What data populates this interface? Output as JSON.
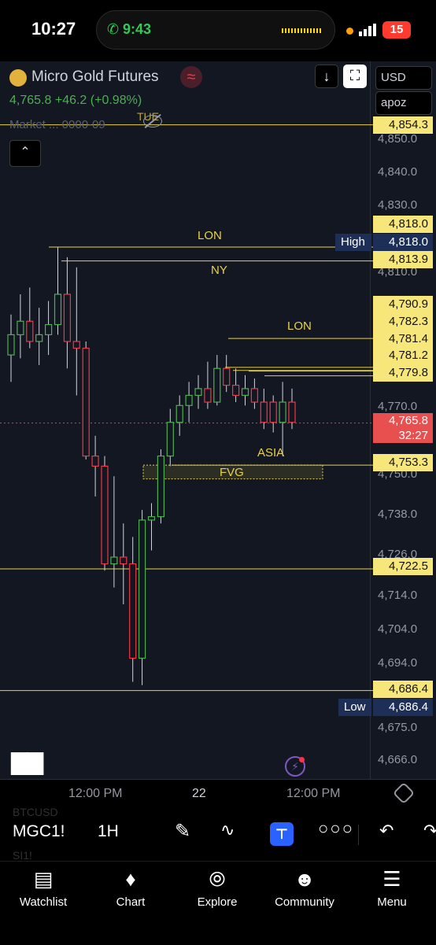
{
  "status": {
    "time": "10:27",
    "call_time": "9:43",
    "battery": "15"
  },
  "header": {
    "symbol_name": "Micro Gold Futures",
    "price": "4,765.8",
    "change": "+46.2 (+0.98%)",
    "market_line": "Market ...  0000-09",
    "hidden_tag": "TUE",
    "currency": "USD",
    "account": "apoz"
  },
  "chart_data": {
    "type": "candlestick",
    "symbol": "MGC1!",
    "interval": "1H",
    "y_ticks": [
      4850.0,
      4840.0,
      4830.0,
      4810.0,
      4770.0,
      4750.0,
      4738.0,
      4726.0,
      4714.0,
      4704.0,
      4694.0,
      4675.0,
      4666.0
    ],
    "y_tick_labels": [
      "4,850.0",
      "4,840.0",
      "4,830.0",
      "4,810.0",
      "4,770.0",
      "4,750.0",
      "4,738.0",
      "4,726.0",
      "4,714.0",
      "4,704.0",
      "4,694.0",
      "4,675.0",
      "4,666.0"
    ],
    "x_labels": [
      "12:00 PM",
      "22",
      "12:00 PM"
    ],
    "levels": [
      {
        "price": 4854.3,
        "label": "4,854.3"
      },
      {
        "price": 4818.0,
        "label": "4,818.0",
        "text": "LON"
      },
      {
        "price": 4813.9,
        "label": "4,813.9",
        "text": "NY"
      },
      {
        "price": 4790.9,
        "label": "4,790.9",
        "text": "LON"
      },
      {
        "price": 4782.3,
        "label": "4,782.3"
      },
      {
        "price": 4781.4,
        "label": "4,781.4"
      },
      {
        "price": 4781.2,
        "label": "4,781.2"
      },
      {
        "price": 4779.8,
        "label": "4,779.8"
      },
      {
        "price": 4753.3,
        "label": "4,753.3",
        "text": "ASIA"
      },
      {
        "price": 4722.5,
        "label": "4,722.5"
      },
      {
        "price": 4686.4,
        "label": "4,686.4"
      }
    ],
    "high": {
      "text": "High",
      "label": "4,818.0"
    },
    "low": {
      "text": "Low",
      "label": "4,686.4"
    },
    "last": {
      "label": "4,765.8",
      "countdown": "32:27"
    },
    "zone": {
      "text": "FVG"
    },
    "candles": [
      {
        "o": 4786,
        "h": 4798,
        "l": 4778,
        "c": 4792
      },
      {
        "o": 4792,
        "h": 4804,
        "l": 4785,
        "c": 4796
      },
      {
        "o": 4796,
        "h": 4806,
        "l": 4788,
        "c": 4790
      },
      {
        "o": 4790,
        "h": 4800,
        "l": 4783,
        "c": 4792
      },
      {
        "o": 4792,
        "h": 4802,
        "l": 4786,
        "c": 4795
      },
      {
        "o": 4795,
        "h": 4818,
        "l": 4792,
        "c": 4804
      },
      {
        "o": 4804,
        "h": 4815,
        "l": 4782,
        "c": 4790
      },
      {
        "o": 4790,
        "h": 4812,
        "l": 4774,
        "c": 4788
      },
      {
        "o": 4788,
        "h": 4790,
        "l": 4755,
        "c": 4756
      },
      {
        "o": 4756,
        "h": 4762,
        "l": 4744,
        "c": 4753
      },
      {
        "o": 4753,
        "h": 4756,
        "l": 4722,
        "c": 4724
      },
      {
        "o": 4724,
        "h": 4750,
        "l": 4717,
        "c": 4726
      },
      {
        "o": 4726,
        "h": 4736,
        "l": 4712,
        "c": 4724
      },
      {
        "o": 4724,
        "h": 4732,
        "l": 4689,
        "c": 4696
      },
      {
        "o": 4696,
        "h": 4740,
        "l": 4688,
        "c": 4737
      },
      {
        "o": 4737,
        "h": 4742,
        "l": 4728,
        "c": 4738
      },
      {
        "o": 4738,
        "h": 4758,
        "l": 4736,
        "c": 4756
      },
      {
        "o": 4756,
        "h": 4770,
        "l": 4753,
        "c": 4766
      },
      {
        "o": 4766,
        "h": 4774,
        "l": 4762,
        "c": 4771
      },
      {
        "o": 4771,
        "h": 4778,
        "l": 4766,
        "c": 4774
      },
      {
        "o": 4774,
        "h": 4780,
        "l": 4770,
        "c": 4776
      },
      {
        "o": 4776,
        "h": 4784,
        "l": 4770,
        "c": 4772
      },
      {
        "o": 4772,
        "h": 4786,
        "l": 4771,
        "c": 4782
      },
      {
        "o": 4782,
        "h": 4786,
        "l": 4775,
        "c": 4777
      },
      {
        "o": 4777,
        "h": 4782,
        "l": 4772,
        "c": 4774
      },
      {
        "o": 4774,
        "h": 4780,
        "l": 4771,
        "c": 4776
      },
      {
        "o": 4776,
        "h": 4779,
        "l": 4770,
        "c": 4772
      },
      {
        "o": 4772,
        "h": 4776,
        "l": 4764,
        "c": 4766
      },
      {
        "o": 4772,
        "h": 4774,
        "l": 4763,
        "c": 4766
      },
      {
        "o": 4766,
        "h": 4778,
        "l": 4756,
        "c": 4772
      },
      {
        "o": 4772,
        "h": 4776,
        "l": 4764,
        "c": 4766
      }
    ]
  },
  "toolbar": {
    "ghost_top": "BTCUSD",
    "symbol": "MGC1!",
    "interval": "1H",
    "ghost_bottom": "SI1!"
  },
  "nav": [
    {
      "label": "Watchlist",
      "icon": "watchlist-icon"
    },
    {
      "label": "Chart",
      "icon": "chart-icon"
    },
    {
      "label": "Explore",
      "icon": "explore-icon"
    },
    {
      "label": "Community",
      "icon": "community-icon"
    },
    {
      "label": "Menu",
      "icon": "menu-icon"
    }
  ],
  "colors": {
    "up": "#4caf50",
    "down": "#f23645",
    "level": "#e8d24a",
    "bg": "#131722"
  }
}
